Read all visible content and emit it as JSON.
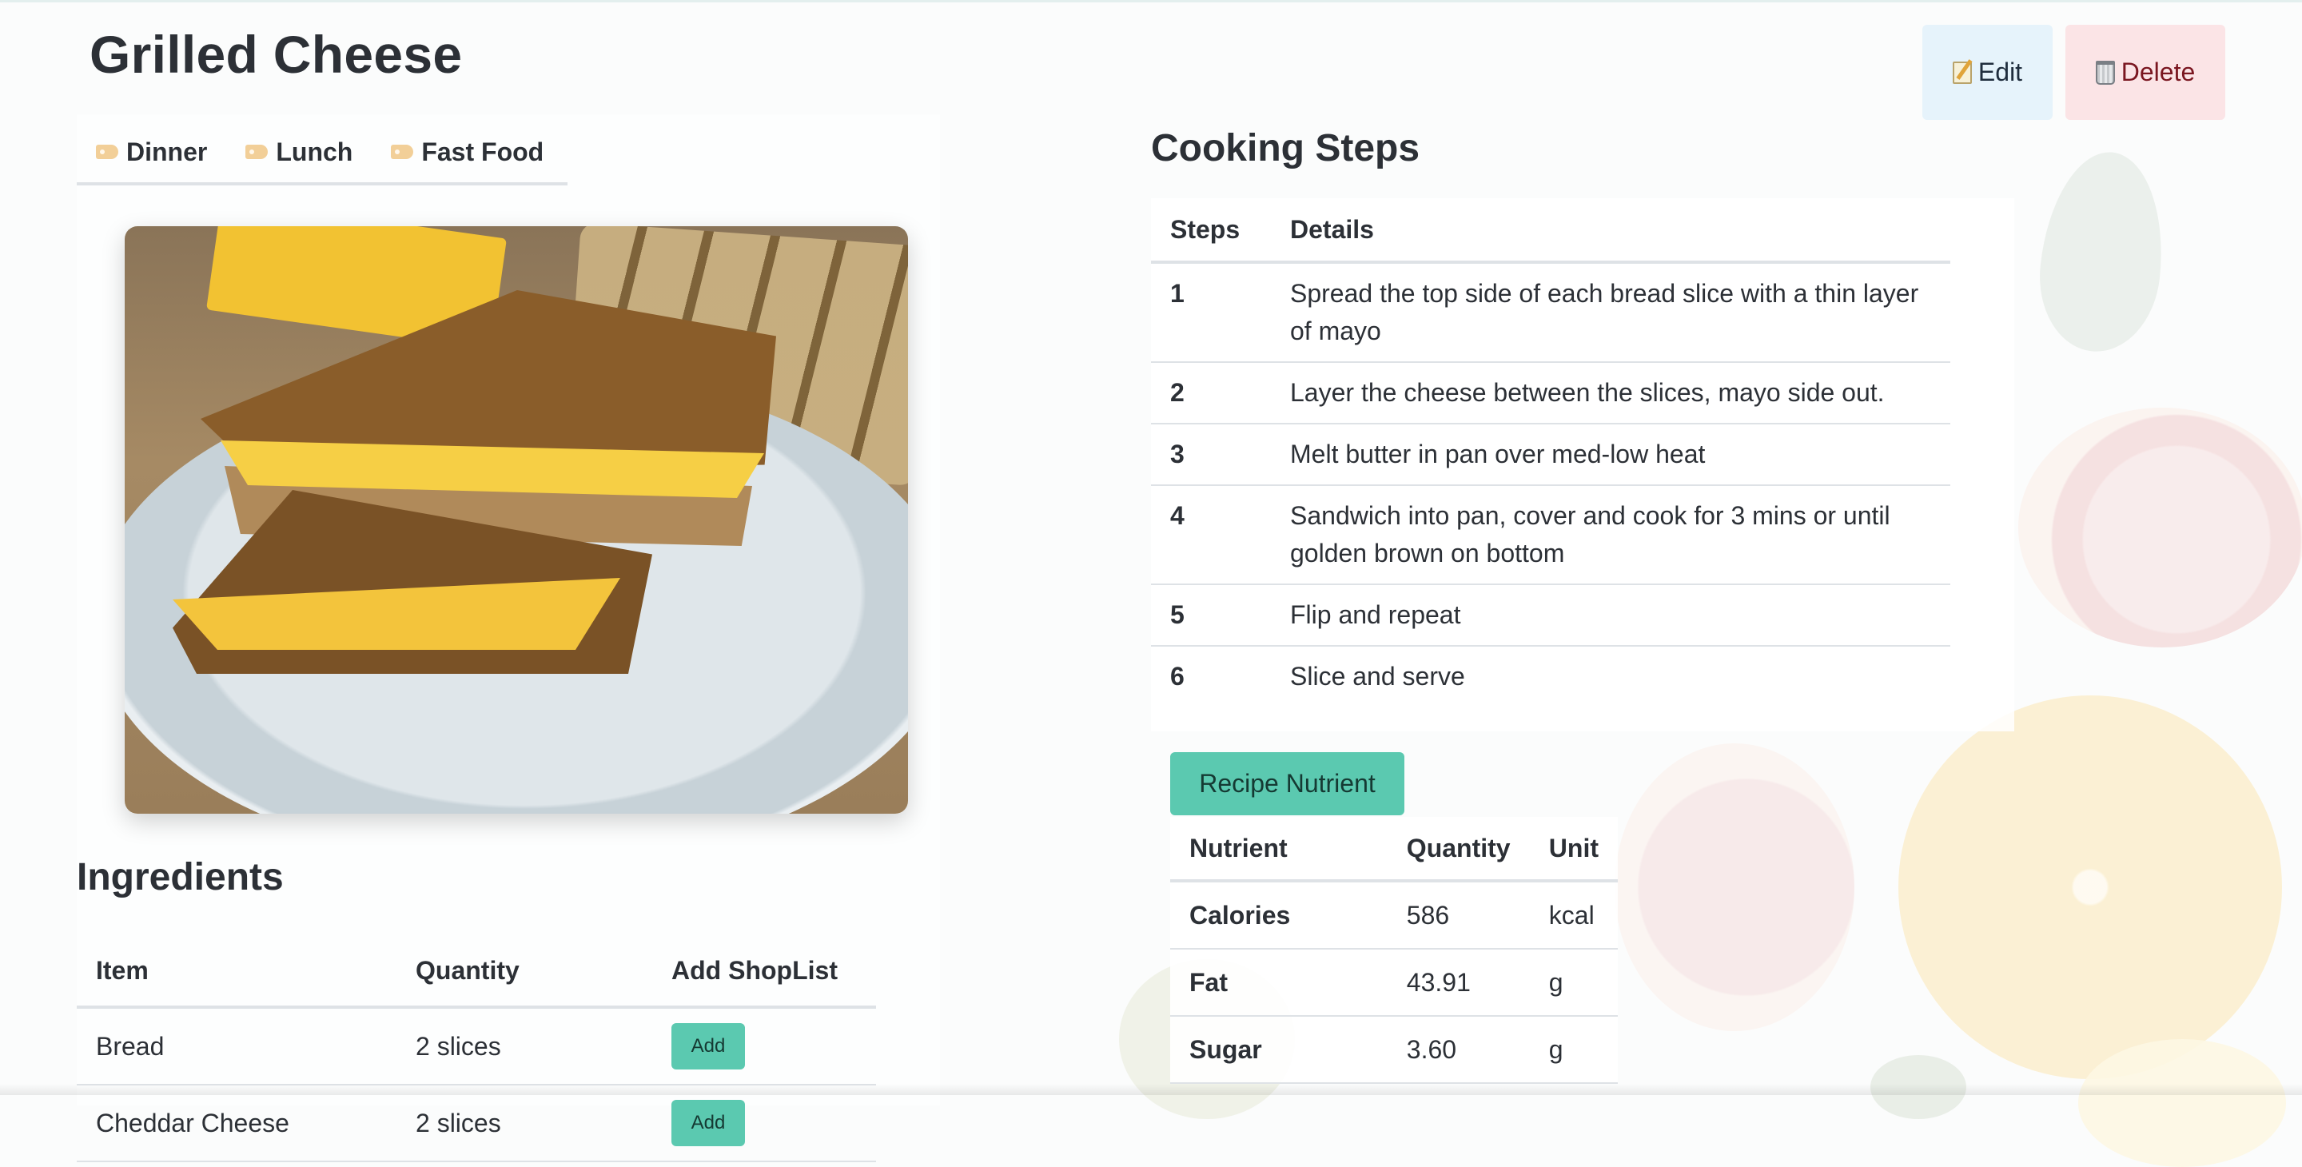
{
  "recipe": {
    "title": "Grilled Cheese",
    "image_alt": "Grilled cheese sandwich on a plate"
  },
  "actions": {
    "edit_label": "Edit",
    "delete_label": "Delete"
  },
  "tags": [
    {
      "label": "Dinner"
    },
    {
      "label": "Lunch"
    },
    {
      "label": "Fast Food"
    }
  ],
  "ingredients": {
    "heading": "Ingredients",
    "columns": [
      "Item",
      "Quantity",
      "Add ShopList"
    ],
    "rows": [
      {
        "item": "Bread",
        "quantity": "2 slices",
        "button": "Add"
      },
      {
        "item": "Cheddar Cheese",
        "quantity": "2 slices",
        "button": "Add"
      }
    ]
  },
  "steps": {
    "heading": "Cooking Steps",
    "columns": [
      "Steps",
      "Details"
    ],
    "rows": [
      {
        "num": "1",
        "detail": "Spread the top side of each bread slice with a thin layer of mayo"
      },
      {
        "num": "2",
        "detail": "Layer the cheese between the slices, mayo side out."
      },
      {
        "num": "3",
        "detail": "Melt butter in pan over med-low heat"
      },
      {
        "num": "4",
        "detail": "Sandwich into pan, cover and cook for 3 mins or until golden brown on bottom"
      },
      {
        "num": "5",
        "detail": "Flip and repeat"
      },
      {
        "num": "6",
        "detail": "Slice and serve"
      }
    ]
  },
  "nutrients": {
    "button_label": "Recipe Nutrient",
    "columns": [
      "Nutrient",
      "Quantity",
      "Unit"
    ],
    "rows": [
      {
        "name": "Calories",
        "quantity": "586",
        "unit": "kcal"
      },
      {
        "name": "Fat",
        "quantity": "43.91",
        "unit": "g"
      },
      {
        "name": "Sugar",
        "quantity": "3.60",
        "unit": "g"
      }
    ]
  },
  "icons": {
    "edit": "memo-icon",
    "delete": "wastebasket-icon",
    "tag": "label-icon"
  },
  "colors": {
    "accent": "#5bc9b0",
    "edit_bg": "#e6f3fb",
    "delete_bg": "#fbe4e6",
    "delete_text": "#7a1620"
  }
}
